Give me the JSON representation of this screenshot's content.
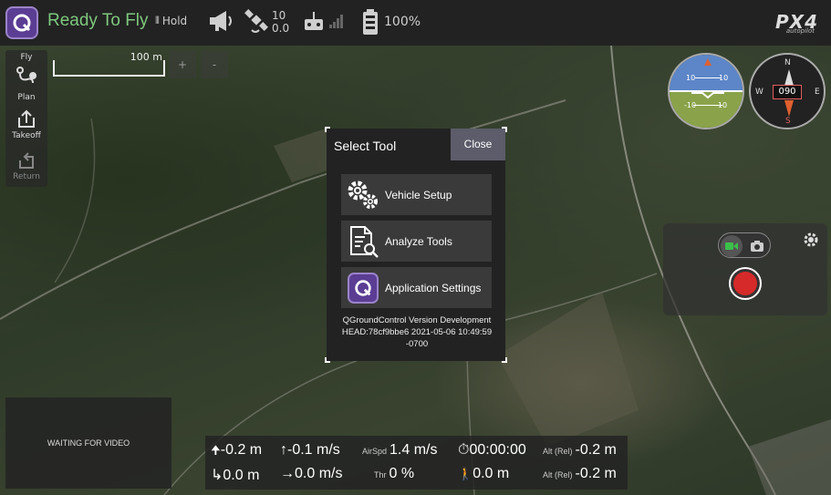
{
  "toolbar": {
    "status": "Ready To Fly",
    "flight_mode": "Hold",
    "gps_sat_count": "10",
    "gps_hdop": "0.0",
    "battery": "100%",
    "brand": "PX4",
    "brand_sub": "autopilot"
  },
  "left_tools": [
    {
      "label": "Fly",
      "icon": "fly-icon",
      "enabled": true
    },
    {
      "label": "Plan",
      "icon": "plan-route-icon",
      "enabled": true
    },
    {
      "label": "Takeoff",
      "icon": "takeoff-icon",
      "enabled": true
    },
    {
      "label": "Return",
      "icon": "return-icon",
      "enabled": false
    }
  ],
  "map": {
    "scale_label": "100 m",
    "zoom_in": "+",
    "zoom_out": "-"
  },
  "compass": {
    "heading": "090",
    "north": "N",
    "east": "E",
    "south": "S",
    "west": "W"
  },
  "attitude": {
    "pitch_marks": [
      "10",
      "10",
      "-10",
      "-10"
    ]
  },
  "dialog": {
    "title": "Select Tool",
    "close_label": "Close",
    "buttons": [
      {
        "label": "Vehicle Setup",
        "icon": "gears-icon"
      },
      {
        "label": "Analyze Tools",
        "icon": "analyze-document-icon"
      },
      {
        "label": "Application Settings",
        "icon": "qgc-logo-icon"
      }
    ],
    "version": "QGroundControl Version Development HEAD:78cf9bbe6 2021-05-06 10:49:59 -0700"
  },
  "video": {
    "status": "WAITING FOR VIDEO"
  },
  "telemetry": {
    "row1": {
      "altitude_change": "-0.2 m",
      "vertical_speed": "-0.1 m/s",
      "airspeed_label": "AirSpd",
      "airspeed": "1.4 m/s",
      "flight_time": "00:00:00",
      "alt_rel_label": "Alt (Rel)",
      "alt_rel": "-0.2 m"
    },
    "row2": {
      "distance_home": "0.0 m",
      "ground_speed": "0.0 m/s",
      "throttle_label": "Thr",
      "throttle": "0 %",
      "distance": "0.0 m",
      "alt_rel_label": "Alt (Rel)",
      "alt_rel": "-0.2 m"
    }
  },
  "colors": {
    "ready_status": "#7ec87e",
    "toolbar_bg": "#222222",
    "dialog_bg": "#222222",
    "close_button": "#5c5c6a",
    "record_button": "#d62a2a",
    "brand_purple": "#5b3d94"
  }
}
